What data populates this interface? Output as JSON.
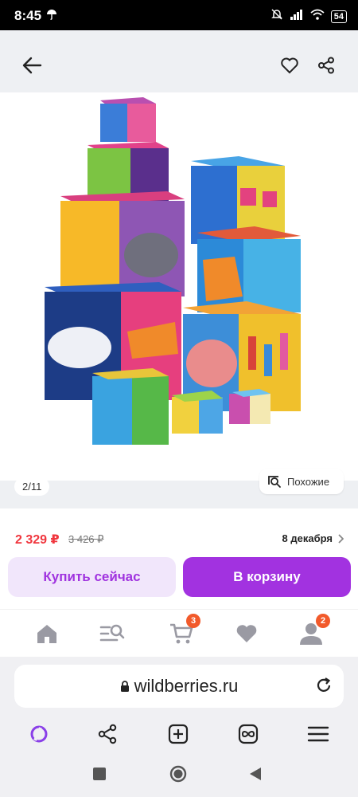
{
  "status_bar": {
    "time": "8:45",
    "battery": "54"
  },
  "gallery": {
    "counter": "2/11",
    "similar_label": "Похожие"
  },
  "product": {
    "price": "2 329 ₽",
    "old_price": "3 426 ₽",
    "delivery": "8 декабря"
  },
  "actions": {
    "buy_now": "Купить сейчас",
    "add_to_cart": "В корзину"
  },
  "nav": {
    "items": [
      {
        "icon": "home-icon"
      },
      {
        "icon": "catalog-search-icon"
      },
      {
        "icon": "cart-icon",
        "badge": "3"
      },
      {
        "icon": "heart-icon"
      },
      {
        "icon": "profile-icon",
        "badge": "2"
      }
    ]
  },
  "browser": {
    "url": "wildberries.ru"
  },
  "colors": {
    "accent": "#a232e0",
    "price": "#f0363e",
    "badge": "#f25a2b"
  }
}
